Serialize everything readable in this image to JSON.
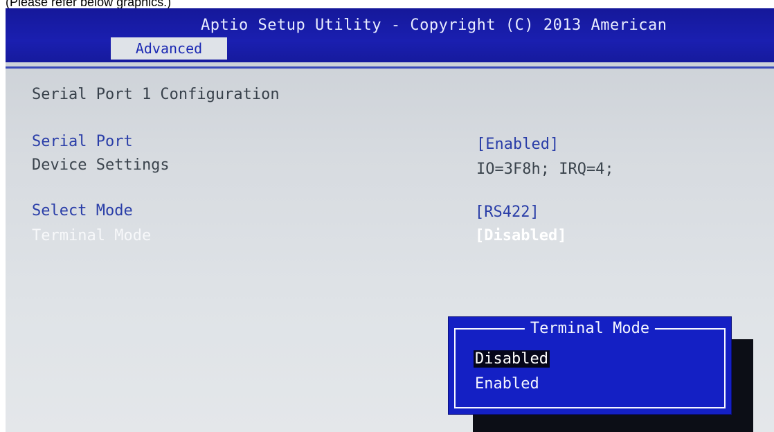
{
  "caption": "(Please refer below graphics.)",
  "header": {
    "title": "Aptio Setup Utility - Copyright (C) 2013 American",
    "active_tab": "Advanced"
  },
  "page": {
    "section_title": "Serial Port 1 Configuration",
    "rows": [
      {
        "label": "Serial Port",
        "value": "[Enabled]"
      },
      {
        "label": "Device Settings",
        "value": "IO=3F8h; IRQ=4;"
      },
      {
        "label": "Select Mode",
        "value": "[RS422]"
      },
      {
        "label": "Terminal Mode",
        "value": "[Disabled]"
      }
    ]
  },
  "popup": {
    "title": "Terminal Mode",
    "options": [
      "Disabled",
      "Enabled"
    ],
    "selected_option": "Disabled"
  },
  "colors": {
    "bios_blue": "#1a1fb0",
    "popup_blue": "#1420c4",
    "link_text": "#2a3ea8",
    "static_text": "#3b444d",
    "highlight_text": "#ffffff"
  }
}
